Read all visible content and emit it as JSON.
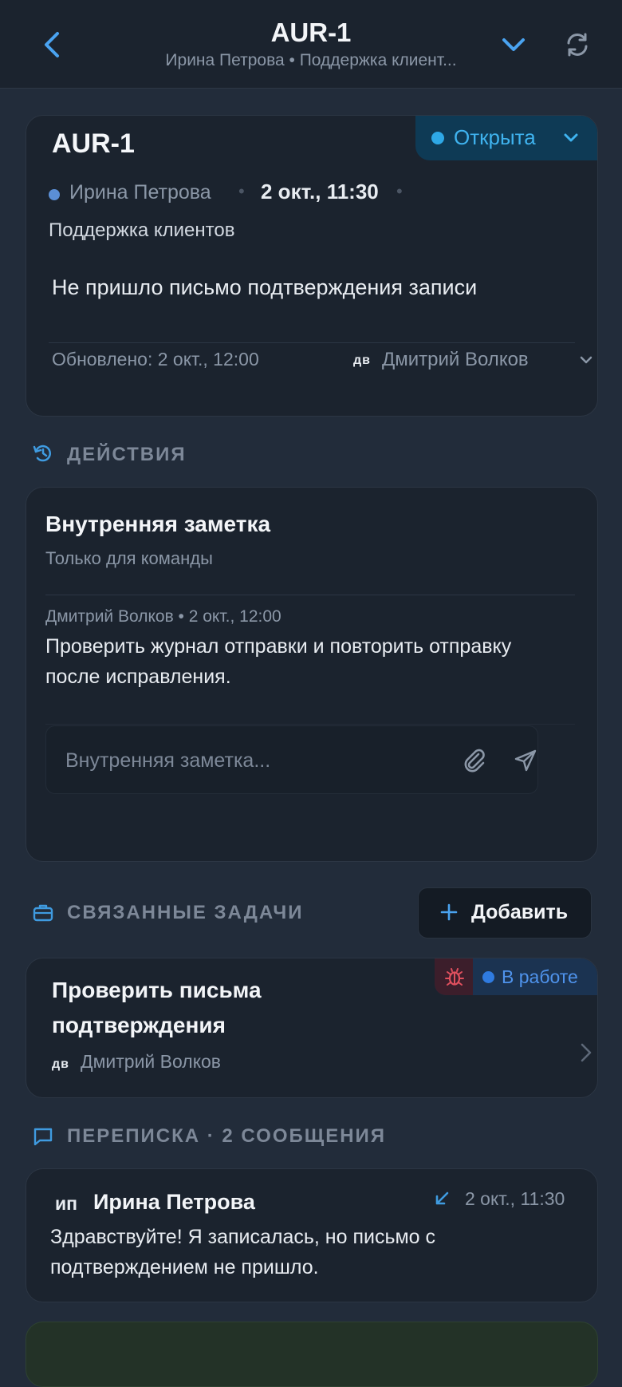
{
  "header": {
    "title": "AUR-1",
    "subtitle": "Ирина Петрова • Поддержка клиент...",
    "back_icon": "chevron-left-icon",
    "expand_icon": "chevron-down-icon",
    "refresh_icon": "refresh-icon"
  },
  "ticket": {
    "id": "AUR-1",
    "status": "Открыта",
    "status_color": "#2ea8e6",
    "author": "Ирина Петрова",
    "separator": "•",
    "created": "2 окт., 11:30",
    "department": "Поддержка клиентов",
    "description": "Не пришло письмо подтверждения записи",
    "updated": "Обновлено: 2 окт., 12:00",
    "assignee_initials": "дв",
    "assignee": "Дмитрий Волков"
  },
  "actions": {
    "label": "ДЕЙСТВИЯ",
    "note": {
      "title": "Внутренняя заметка",
      "subtitle": "Только для команды",
      "meta": "Дмитрий Волков • 2 окт., 12:00",
      "text": "Проверить журнал отправки и повторить отправку после исправления.",
      "input_placeholder": "Внутренняя заметка...",
      "input_value": ""
    }
  },
  "related": {
    "label": "СВЯЗАННЫЕ ЗАДАЧИ",
    "add_label": "Добавить",
    "tasks": [
      {
        "title": "Проверить письма подтверждения",
        "status": "В работе",
        "status_color": "#2f7be0",
        "type_icon": "bug-icon",
        "assignee_initials": "дв",
        "assignee": "Дмитрий Волков"
      }
    ]
  },
  "conversation": {
    "label": "ПЕРЕПИСКА · 2 СООБЩЕНИЯ",
    "messages": [
      {
        "initials": "ип",
        "author": "Ирина Петрова",
        "direction_icon": "incoming-arrow-icon",
        "time": "2 окт., 11:30",
        "text": "Здравствуйте! Я записалась, но письмо с подтверждением не пришло."
      }
    ]
  }
}
